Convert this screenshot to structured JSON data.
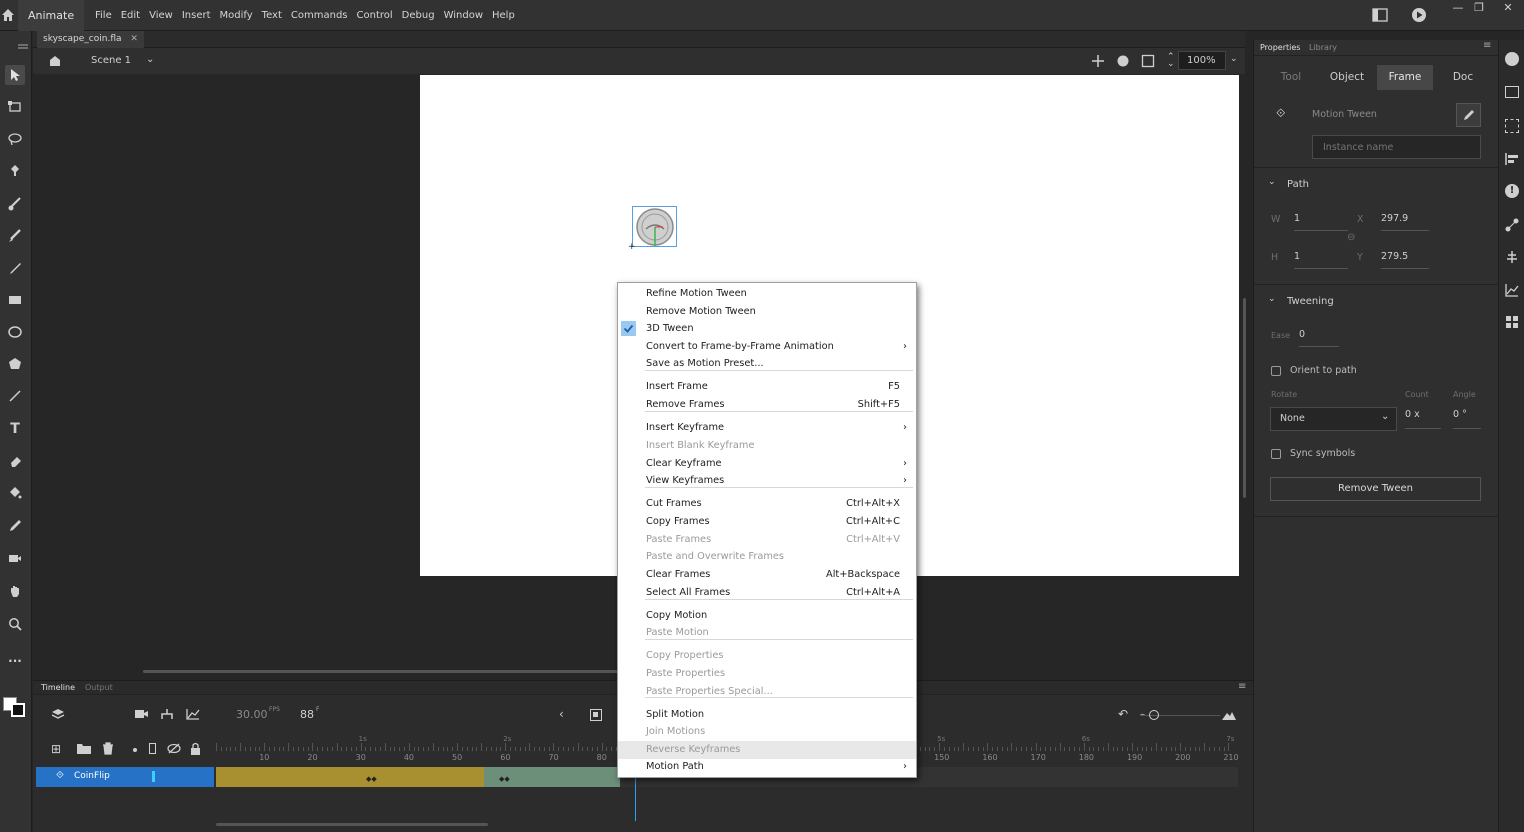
{
  "app": {
    "name": "Animate",
    "menu": [
      "File",
      "Edit",
      "View",
      "Insert",
      "Modify",
      "Text",
      "Commands",
      "Control",
      "Debug",
      "Window",
      "Help"
    ]
  },
  "document": {
    "tab_title": "skyscape_coin.fla",
    "scene": "Scene 1",
    "zoom": "100%"
  },
  "context_menu": {
    "items": [
      {
        "label": "Refine Motion Tween",
        "state": "enabled"
      },
      {
        "label": "Remove Motion Tween",
        "state": "enabled"
      },
      {
        "label": "3D Tween",
        "state": "checked"
      },
      {
        "label": "Convert to Frame-by-Frame Animation",
        "state": "submenu"
      },
      {
        "label": "Save as Motion Preset...",
        "state": "enabled"
      },
      {
        "label": "Insert Frame",
        "shortcut": "F5",
        "state": "enabled"
      },
      {
        "label": "Remove Frames",
        "shortcut": "Shift+F5",
        "state": "enabled"
      },
      {
        "label": "Insert Keyframe",
        "state": "submenu"
      },
      {
        "label": "Insert Blank Keyframe",
        "state": "disabled"
      },
      {
        "label": "Clear Keyframe",
        "state": "submenu"
      },
      {
        "label": "View Keyframes",
        "state": "submenu"
      },
      {
        "label": "Cut Frames",
        "shortcut": "Ctrl+Alt+X",
        "state": "enabled"
      },
      {
        "label": "Copy Frames",
        "shortcut": "Ctrl+Alt+C",
        "state": "enabled"
      },
      {
        "label": "Paste Frames",
        "shortcut": "Ctrl+Alt+V",
        "state": "disabled"
      },
      {
        "label": "Paste and Overwrite Frames",
        "state": "disabled"
      },
      {
        "label": "Clear Frames",
        "shortcut": "Alt+Backspace",
        "state": "enabled"
      },
      {
        "label": "Select All Frames",
        "shortcut": "Ctrl+Alt+A",
        "state": "enabled"
      },
      {
        "label": "Copy Motion",
        "state": "enabled"
      },
      {
        "label": "Paste Motion",
        "state": "disabled"
      },
      {
        "label": "Copy Properties",
        "state": "disabled"
      },
      {
        "label": "Paste Properties",
        "state": "disabled"
      },
      {
        "label": "Paste Properties Special...",
        "state": "disabled"
      },
      {
        "label": "Split Motion",
        "state": "enabled"
      },
      {
        "label": "Join Motions",
        "state": "disabled"
      },
      {
        "label": "Reverse Keyframes",
        "state": "hover-disabled"
      },
      {
        "label": "Motion Path",
        "state": "submenu"
      }
    ]
  },
  "properties_panel": {
    "panel_tabs": [
      "Properties",
      "Library"
    ],
    "tabs": [
      "Tool",
      "Object",
      "Frame",
      "Doc"
    ],
    "selected_tab": "Frame",
    "type": "Motion Tween",
    "instance_name_placeholder": "Instance name",
    "path": {
      "title": "Path",
      "w_label": "W",
      "w_value": "1",
      "h_label": "H",
      "h_value": "1",
      "x_label": "X",
      "x_value": "297.9",
      "y_label": "Y",
      "y_value": "279.5"
    },
    "tweening": {
      "title": "Tweening",
      "ease_label": "Ease",
      "ease_value": "0",
      "orient_label": "Orient to path",
      "rotate_label": "Rotate",
      "count_label": "Count",
      "angle_label": "Angle",
      "rotate_value": "None",
      "count_value": "0 x",
      "angle_value": "0 °",
      "sync_label": "Sync symbols",
      "remove_button": "Remove Tween"
    }
  },
  "timeline": {
    "tabs": [
      "Timeline",
      "Output"
    ],
    "fps": "30.00",
    "fps_unit": "FPS",
    "frame": "88",
    "frame_unit": "F",
    "layer": "CoinFlip",
    "frame_ruler": [
      "10",
      "20",
      "30",
      "40",
      "50",
      "60",
      "70",
      "80",
      "150",
      "160",
      "170",
      "180",
      "190",
      "200",
      "210"
    ],
    "second_marks": [
      "1s",
      "2s",
      "5s",
      "6s",
      "7s"
    ]
  }
}
